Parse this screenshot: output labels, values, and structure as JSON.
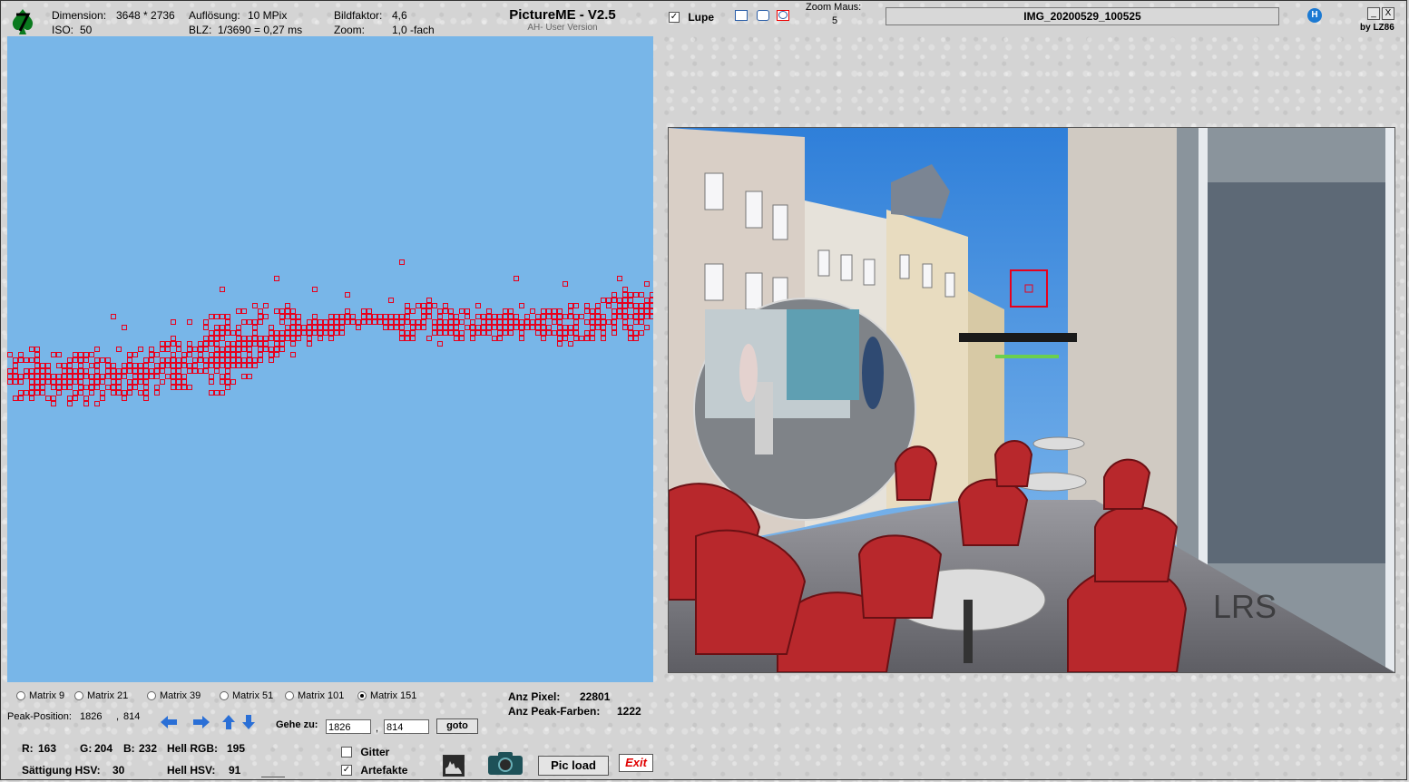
{
  "header": {
    "dimension_label": "Dimension:",
    "dimension_value": "3648 * 2736",
    "iso_label": "ISO:",
    "iso_value": "50",
    "resolution_label": "Auflösung:",
    "resolution_value": "10 MPix",
    "shutter_label": "BLZ:",
    "shutter_value": "1/3690 = 0,27 ms",
    "factor_label": "Bildfaktor:",
    "factor_value": "4,6",
    "zoom_label": "Zoom:",
    "zoom_value": "1,0 -fach",
    "app_title": "PictureME - V2.5",
    "app_subtitle": "AH- User Version",
    "lupe_label": "Lupe",
    "lupe_checked": "✓",
    "zoom_mouse_label": "Zoom Maus:",
    "zoom_mouse_value": "5",
    "filename": "IMG_20200529_100525",
    "help_glyph": "H",
    "minimize_glyph": "_",
    "close_glyph": "X",
    "author": "by LZ86"
  },
  "matrix_options": [
    {
      "label": "Matrix 9",
      "selected": false
    },
    {
      "label": "Matrix 21",
      "selected": false
    },
    {
      "label": "Matrix 39",
      "selected": false
    },
    {
      "label": "Matrix 51",
      "selected": false
    },
    {
      "label": "Matrix 101",
      "selected": false
    },
    {
      "label": "Matrix 151",
      "selected": true
    }
  ],
  "stats": {
    "pixel_label": "Anz Pixel:",
    "pixel_value": "22801",
    "peak_colors_label": "Anz Peak-Farben:",
    "peak_colors_value": "1222"
  },
  "peak": {
    "label": "Peak-Position:",
    "x": "1826",
    "sep": ",",
    "y": "814"
  },
  "goto": {
    "label": "Gehe zu:",
    "x_value": "1826",
    "y_value": "814",
    "sep": ",",
    "button": "goto"
  },
  "color_info": {
    "r_label": "R:",
    "r_value": "163",
    "g_label": "G:",
    "g_value": "204",
    "b_label": "B:",
    "b_value": "232",
    "hell_rgb_label": "Hell RGB:",
    "hell_rgb_value": "195",
    "sat_label": "Sättigung HSV:",
    "sat_value": "30",
    "hell_hsv_label": "Hell HSV:",
    "hell_hsv_value": "91"
  },
  "options": {
    "gitter_label": "Gitter",
    "gitter_checked": "",
    "artefakte_label": "Artefakte",
    "artefakte_checked": "✓"
  },
  "buttons": {
    "pic_load": "Pic load",
    "exit": "Exit"
  },
  "icons": {
    "logo": "spade-logo-icon",
    "histogram": "histogram-icon",
    "camera": "camera-icon",
    "left": "arrow-left-icon",
    "right": "arrow-right-icon",
    "up": "arrow-up-icon",
    "down": "arrow-down-icon"
  },
  "colors": {
    "sky": "#78b6e8",
    "marker": "#e8001c",
    "accent_blue": "#2a6fd6"
  }
}
